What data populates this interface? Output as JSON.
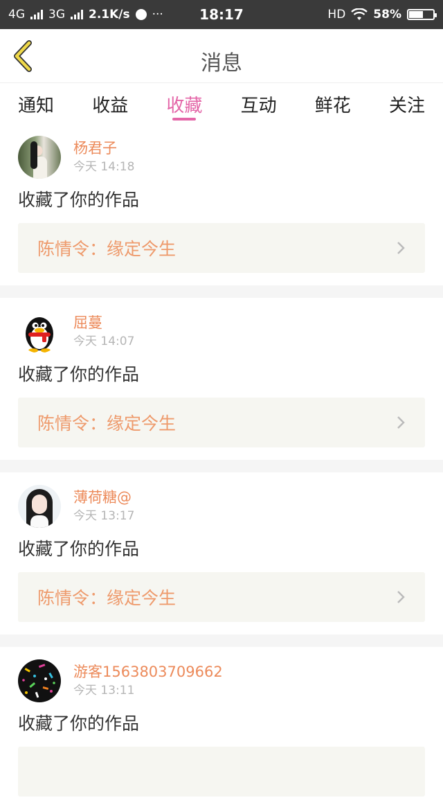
{
  "status_bar": {
    "network_4g": "4G",
    "network_3g": "3G",
    "speed": "2.1K/s",
    "more": "···",
    "time": "18:17",
    "hd": "HD",
    "battery": "58%",
    "battery_level": 0.58
  },
  "header": {
    "title": "消息",
    "back_icon": "chevron-left-icon",
    "accent": "#f0d94a"
  },
  "tabs": [
    {
      "label": "通知",
      "active": false
    },
    {
      "label": "收益",
      "active": false
    },
    {
      "label": "收藏",
      "active": true
    },
    {
      "label": "互动",
      "active": false
    },
    {
      "label": "鲜花",
      "active": false
    },
    {
      "label": "关注",
      "active": false
    }
  ],
  "colors": {
    "tab_active": "#e466a8",
    "username": "#ec8a5a",
    "work_title": "#ee9a6c",
    "card_link_bg": "#f6f6f1"
  },
  "messages": [
    {
      "username": "杨君子",
      "time": "今天 14:18",
      "action": "收藏了你的作品",
      "work": "陈情令：缘定今生",
      "avatar": "avatar-photo-girl"
    },
    {
      "username": "屈蔓",
      "time": "今天 14:07",
      "action": "收藏了你的作品",
      "work": "陈情令：缘定今生",
      "avatar": "avatar-penguin"
    },
    {
      "username": "薄荷糖@",
      "time": "今天 13:17",
      "action": "收藏了你的作品",
      "work": "陈情令：缘定今生",
      "avatar": "avatar-photo-woman"
    },
    {
      "username": "游客1563803709662",
      "time": "今天 13:11",
      "action": "收藏了你的作品",
      "work": "",
      "avatar": "avatar-confetti"
    }
  ]
}
